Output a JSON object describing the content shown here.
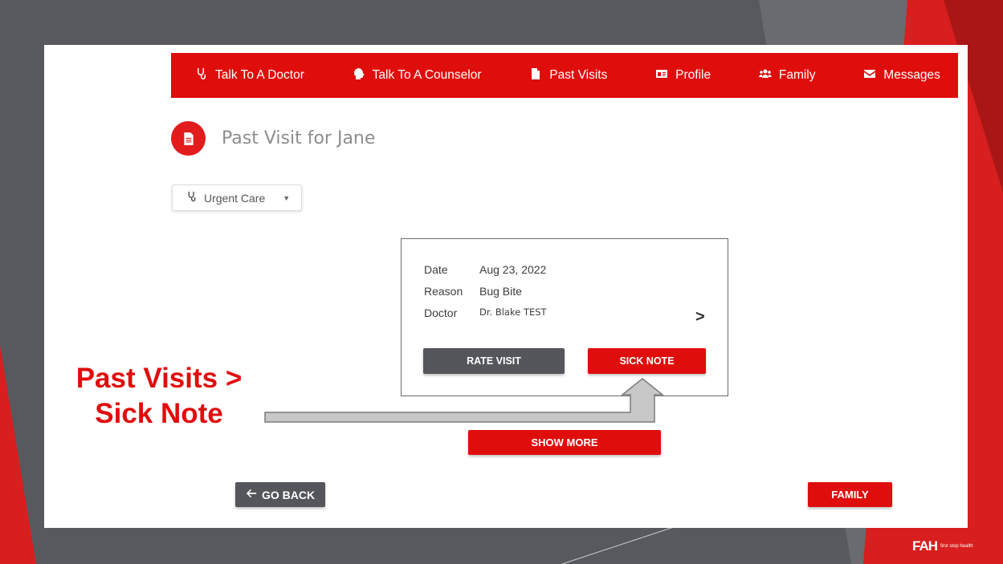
{
  "nav": {
    "items": [
      {
        "label": "Talk To A Doctor",
        "icon": "stethoscope-icon"
      },
      {
        "label": "Talk To A Counselor",
        "icon": "head-icon"
      },
      {
        "label": "Past Visits",
        "icon": "document-icon"
      },
      {
        "label": "Profile",
        "icon": "id-card-icon"
      },
      {
        "label": "Family",
        "icon": "users-icon"
      },
      {
        "label": "Messages",
        "icon": "envelope-icon"
      }
    ]
  },
  "page": {
    "title": "Past Visit for Jane"
  },
  "filter": {
    "selected": "Urgent Care"
  },
  "visit": {
    "date_label": "Date",
    "date": "Aug 23, 2022",
    "reason_label": "Reason",
    "reason": "Bug Bite",
    "doctor_label": "Doctor",
    "doctor": "Dr. Blake TEST"
  },
  "buttons": {
    "rate": "RATE VISIT",
    "sick": "SICK NOTE",
    "more": "SHOW MORE",
    "back": "GO BACK",
    "family": "FAMILY"
  },
  "callout": {
    "line1": "Past Visits >",
    "line2": "Sick Note"
  },
  "logo": {
    "mark": "FAH",
    "text": "first stop health"
  },
  "colors": {
    "brand_red": "#e00d0d",
    "dark_gray": "#55565b"
  }
}
